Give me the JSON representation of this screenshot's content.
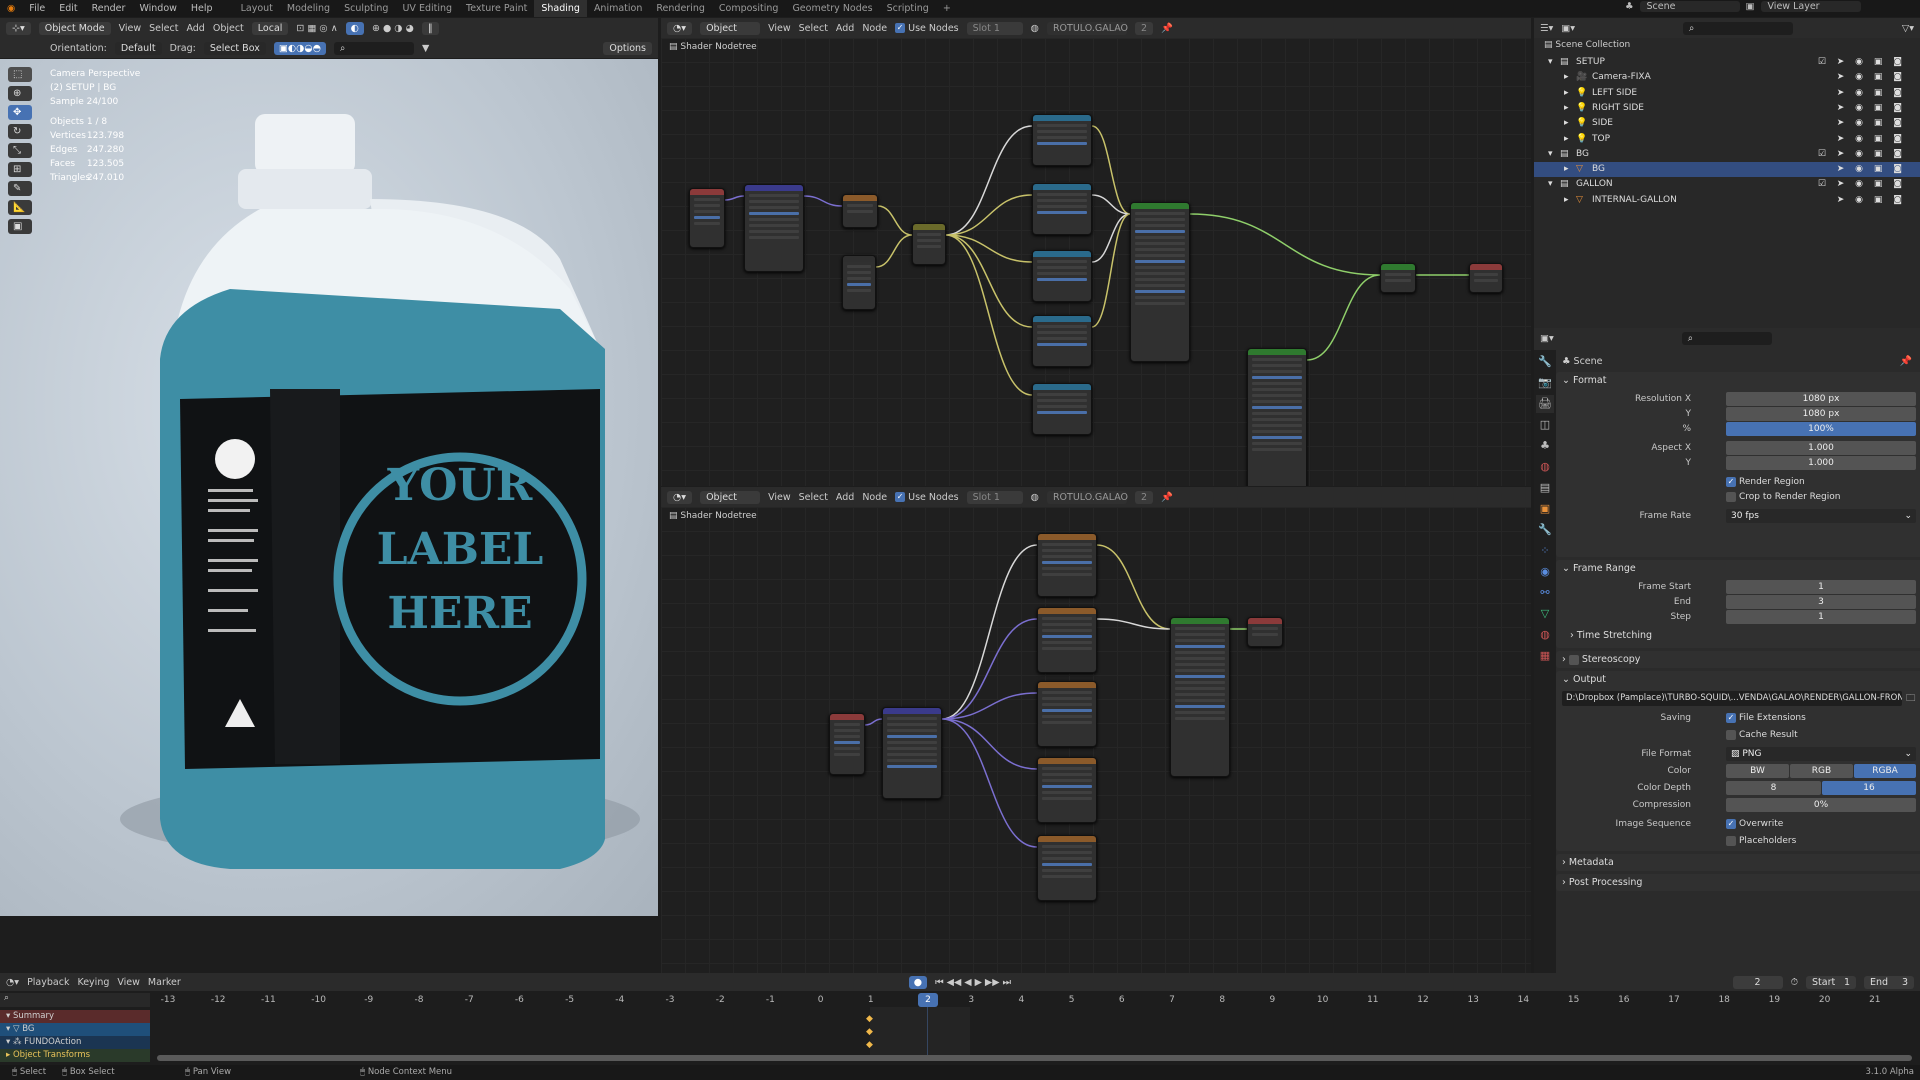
{
  "topbar": {
    "menus": [
      "File",
      "Edit",
      "Render",
      "Window",
      "Help"
    ],
    "workspaces": [
      "Layout",
      "Modeling",
      "Sculpting",
      "UV Editing",
      "Texture Paint",
      "Shading",
      "Animation",
      "Rendering",
      "Compositing",
      "Geometry Nodes",
      "Scripting",
      "+"
    ],
    "active_workspace": "Shading",
    "scene": "Scene",
    "view_layer": "View Layer"
  },
  "viewport": {
    "mode": "Object Mode",
    "menus": [
      "View",
      "Select",
      "Add",
      "Object"
    ],
    "transform": "Local",
    "orientation_label": "Orientation:",
    "orientation": "Default",
    "drag_label": "Drag:",
    "drag": "Select Box",
    "options": "Options",
    "overlay": {
      "camera": "Camera Perspective",
      "collection": "(2) SETUP | BG",
      "sample": "Sample 24/100",
      "stats": [
        [
          "Objects",
          "1 / 8"
        ],
        [
          "Vertices",
          "123.798"
        ],
        [
          "Edges",
          "247.280"
        ],
        [
          "Faces",
          "123.505"
        ],
        [
          "Triangles",
          "247.010"
        ]
      ]
    },
    "label_text": [
      "YOUR",
      "LABEL",
      "HERE"
    ]
  },
  "node_editor_top": {
    "type": "Object",
    "menus": [
      "View",
      "Select",
      "Add",
      "Node"
    ],
    "use_nodes": "Use Nodes",
    "slot": "Slot 1",
    "material": "ROTULO.GALAO",
    "users": "2",
    "breadcrumb": "Shader Nodetree"
  },
  "node_editor_bottom": {
    "type": "Object",
    "menus": [
      "View",
      "Select",
      "Add",
      "Node"
    ],
    "use_nodes": "Use Nodes",
    "slot": "Slot 1",
    "material": "ROTULO.GALAO",
    "users": "2",
    "breadcrumb": "Shader Nodetree"
  },
  "outliner": {
    "root": "Scene Collection",
    "rows": [
      {
        "name": "SETUP",
        "level": 0,
        "kind": "collection"
      },
      {
        "name": "Camera-FIXA",
        "level": 1,
        "kind": "camera"
      },
      {
        "name": "LEFT SIDE",
        "level": 1,
        "kind": "light"
      },
      {
        "name": "RIGHT SIDE",
        "level": 1,
        "kind": "light"
      },
      {
        "name": "SIDE",
        "level": 1,
        "kind": "light"
      },
      {
        "name": "TOP",
        "level": 1,
        "kind": "light"
      },
      {
        "name": "BG",
        "level": 0,
        "kind": "collection"
      },
      {
        "name": "BG",
        "level": 1,
        "kind": "mesh",
        "selected": true
      },
      {
        "name": "GALLON",
        "level": 0,
        "kind": "collection"
      },
      {
        "name": "INTERNAL-GALLON",
        "level": 1,
        "kind": "mesh"
      }
    ]
  },
  "properties": {
    "context": "Scene",
    "format": {
      "title": "Format",
      "res_x_label": "Resolution X",
      "res_x": "1080 px",
      "res_y_label": "Y",
      "res_y": "1080 px",
      "pct_label": "%",
      "pct": "100%",
      "aspect_x_label": "Aspect X",
      "aspect_x": "1.000",
      "aspect_y_label": "Y",
      "aspect_y": "1.000",
      "render_region": "Render Region",
      "crop": "Crop to Render Region",
      "fps_label": "Frame Rate",
      "fps": "30 fps"
    },
    "frame_range": {
      "title": "Frame Range",
      "start_label": "Frame Start",
      "start": "1",
      "end_label": "End",
      "end": "3",
      "step_label": "Step",
      "step": "1",
      "time_stretching": "Time Stretching"
    },
    "stereoscopy": "Stereoscopy",
    "output": {
      "title": "Output",
      "path": "D:\\Dropbox (Pamplace)\\TURBO-SQUID\\...VENDA\\GALAO\\RENDER\\GALLON-FRONT",
      "saving_label": "Saving",
      "file_ext": "File Extensions",
      "cache": "Cache Result",
      "format_label": "File Format",
      "format": "PNG",
      "color_label": "Color",
      "color_opts": [
        "BW",
        "RGB",
        "RGBA"
      ],
      "depth_label": "Color Depth",
      "depth_opts": [
        "8",
        "16"
      ],
      "compression_label": "Compression",
      "compression": "0%",
      "seq_label": "Image Sequence",
      "overwrite": "Overwrite",
      "placeholders": "Placeholders"
    },
    "metadata": "Metadata",
    "post": "Post Processing"
  },
  "timeline": {
    "menus": [
      "Playback",
      "Keying",
      "View",
      "Marker"
    ],
    "current_frame": "2",
    "start_label": "Start",
    "start": "1",
    "end_label": "End",
    "end": "3",
    "ticks": [
      "-13",
      "-12",
      "-11",
      "-10",
      "-9",
      "-8",
      "-7",
      "-6",
      "-5",
      "-4",
      "-3",
      "-2",
      "-1",
      "0",
      "1",
      "2",
      "3",
      "4",
      "5",
      "6",
      "7",
      "8",
      "9",
      "10",
      "11",
      "12",
      "13",
      "14",
      "15",
      "16",
      "17",
      "18",
      "19",
      "20",
      "21"
    ],
    "channels": [
      "Summary",
      "BG",
      "FUNDOAction",
      "Object Transforms"
    ]
  },
  "statusbar": {
    "items": [
      "Select",
      "Box Select",
      "Pan View",
      "Node Context Menu"
    ],
    "version": "3.1.0 Alpha"
  }
}
